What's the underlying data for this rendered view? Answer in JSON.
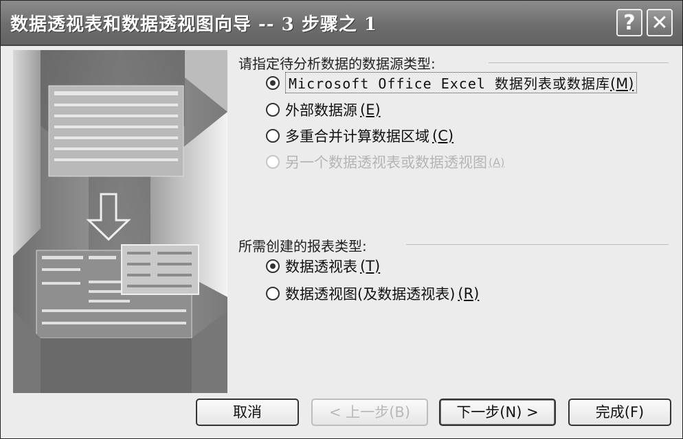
{
  "window": {
    "title": "数据透视表和数据透视图向导 -- 3 步骤之 1",
    "help_label": "?",
    "close_label": "✕"
  },
  "source": {
    "heading": "请指定待分析数据的数据源类型:",
    "options": [
      {
        "label": "Microsoft Office Excel 数据列表或数据库",
        "key": "(M)",
        "selected": true,
        "enabled": true
      },
      {
        "label": "外部数据源",
        "key": "(E)",
        "selected": false,
        "enabled": true
      },
      {
        "label": "多重合并计算数据区域",
        "key": "(C)",
        "selected": false,
        "enabled": true
      },
      {
        "label": "另一个数据透视表或数据透视图",
        "key": "(A)",
        "selected": false,
        "enabled": false
      }
    ]
  },
  "report": {
    "heading": "所需创建的报表类型:",
    "options": [
      {
        "label": "数据透视表",
        "key": "(T)",
        "selected": true,
        "enabled": true
      },
      {
        "label": "数据透视图(及数据透视表)",
        "key": "(R)",
        "selected": false,
        "enabled": true
      }
    ]
  },
  "buttons": {
    "cancel": "取消",
    "back": "< 上一步(B)",
    "next": "下一步(N) >",
    "finish": "完成(F)"
  }
}
